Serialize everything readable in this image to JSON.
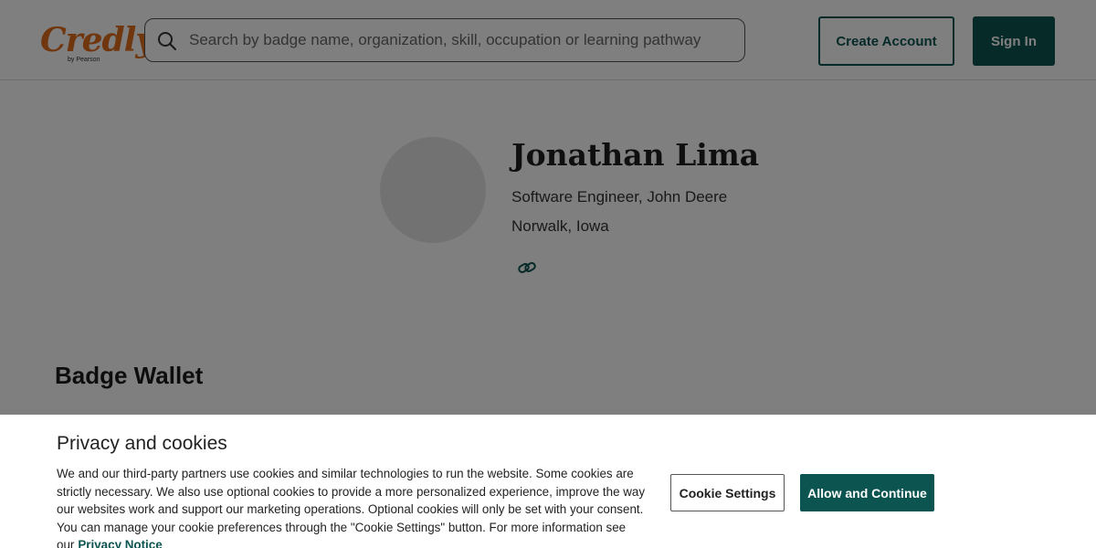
{
  "header": {
    "logo_text": "Credly",
    "logo_subtext": "by Pearson",
    "search_placeholder": "Search by badge name, organization, skill, occupation or learning pathway",
    "create_account_label": "Create Account",
    "sign_in_label": "Sign In"
  },
  "profile": {
    "name": "Jonathan Lima",
    "title": "Software Engineer, John Deere",
    "location": "Norwalk, Iowa",
    "link_icon": "link-icon"
  },
  "badge_wallet": {
    "title": "Badge Wallet"
  },
  "cookie_banner": {
    "title": "Privacy and cookies",
    "body": "We and our third-party partners use cookies and similar technologies to run the website. Some cookies are strictly necessary. We also use optional cookies to provide a more personalized experience, improve the way our websites work and support our marketing operations. Optional cookies will only be set with your consent. You can manage your cookie preferences through the \"Cookie Settings\" button. For more information see our",
    "privacy_link": "Privacy Notice",
    "cookie_settings_label": "Cookie Settings",
    "allow_label": "Allow and Continue"
  },
  "colors": {
    "brand_orange": "#e06d1a",
    "brand_teal": "#0c5450"
  }
}
